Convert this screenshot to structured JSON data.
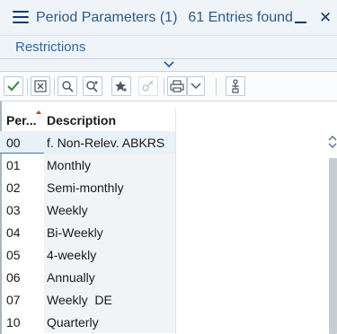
{
  "titlebar": {
    "title": "Period Parameters (1)",
    "entries": "61 Entries found",
    "menu_icon": "hamburger-menu-icon",
    "minimize_icon": "minimize-icon",
    "close_icon": "close-icon",
    "close_glyph": "✕"
  },
  "restrictions": {
    "label": "Restrictions",
    "toggle_icon": "chevron-down-icon"
  },
  "toolbar": {
    "buttons": [
      {
        "icon": "checkmark-icon"
      },
      {
        "icon": "cancel-icon"
      },
      {
        "icon": "search-icon"
      },
      {
        "icon": "search-next-icon"
      },
      {
        "icon": "favorite-star-icon"
      },
      {
        "icon": "hide-personalization-icon"
      },
      {
        "icon": "print-icon"
      },
      {
        "icon": "dropdown-arrow-icon"
      },
      {
        "icon": "settings-icon"
      }
    ]
  },
  "table": {
    "columns": [
      "Per...",
      "Description"
    ],
    "sort_indicator": "sort-indicator-icon",
    "rows": [
      {
        "code": "00",
        "description": "f. Non-Relev. ABKRS",
        "selected": true
      },
      {
        "code": "01",
        "description": "Monthly"
      },
      {
        "code": "02",
        "description": "Semi-monthly"
      },
      {
        "code": "03",
        "description": "Weekly"
      },
      {
        "code": "04",
        "description": "Bi-Weekly"
      },
      {
        "code": "05",
        "description": "4-weekly"
      },
      {
        "code": "06",
        "description": "Annually"
      },
      {
        "code": "07",
        "description": "Weekly  DE"
      },
      {
        "code": "10",
        "description": "Quarterly"
      }
    ]
  },
  "colors": {
    "accent": "#2a6aa8",
    "check": "#2b8a3e",
    "selection_border": "#2e78c6"
  }
}
